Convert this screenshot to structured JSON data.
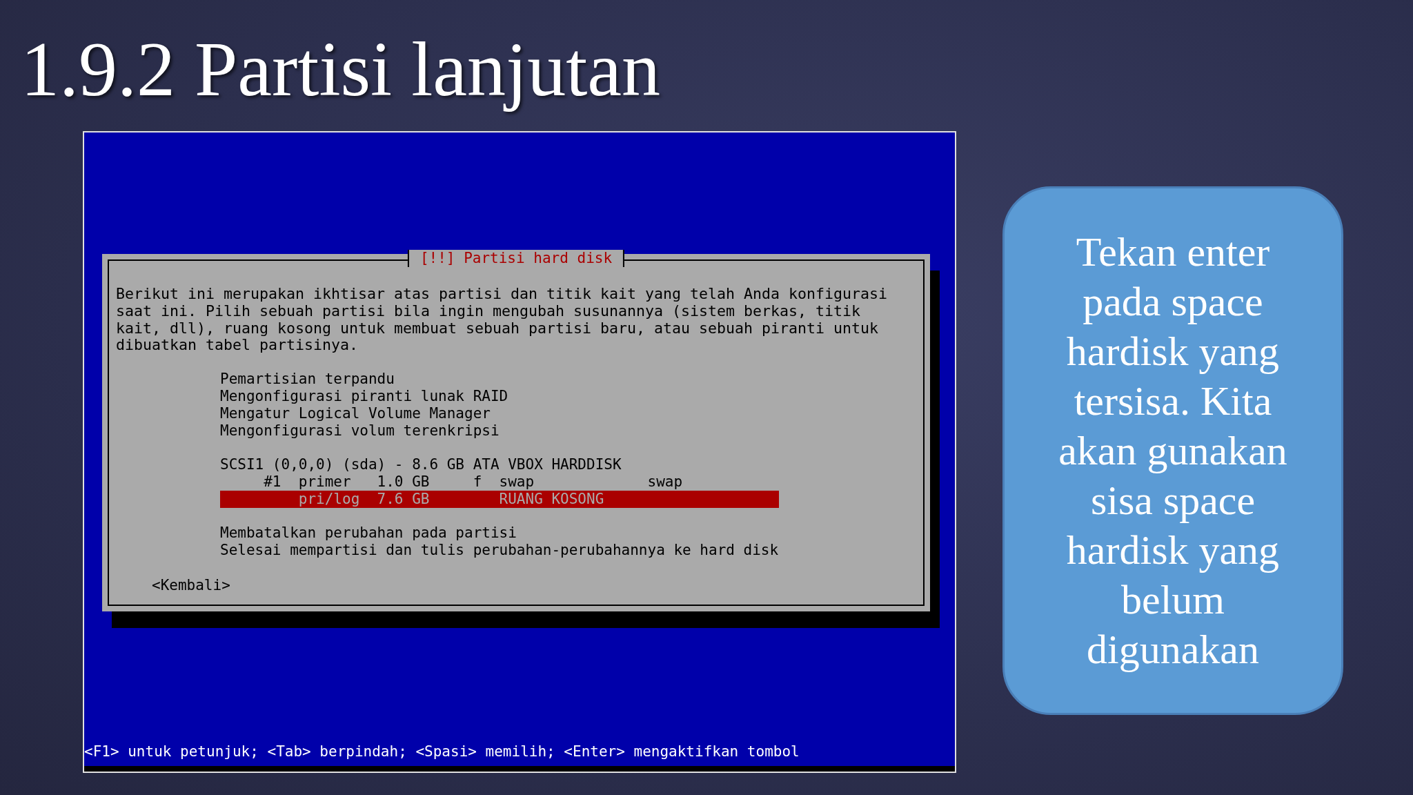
{
  "slide_title": "1.9.2 Partisi lanjutan",
  "installer": {
    "dialog_title": "[!!] Partisi hard disk",
    "description": "Berikut ini merupakan ikhtisar atas partisi dan titik kait yang telah Anda konfigurasi saat ini. Pilih sebuah partisi bila ingin mengubah susunannya (sistem berkas, titik kait, dll), ruang kosong untuk membuat sebuah partisi baru, atau sebuah piranti untuk dibuatkan tabel partisinya.",
    "menu_groups": [
      [
        {
          "text": "Pemartisian terpandu",
          "selected": false
        },
        {
          "text": "Mengonfigurasi piranti lunak RAID",
          "selected": false
        },
        {
          "text": "Mengatur Logical Volume Manager",
          "selected": false
        },
        {
          "text": "Mengonfigurasi volum terenkripsi",
          "selected": false
        }
      ],
      [
        {
          "text": "SCSI1 (0,0,0) (sda) - 8.6 GB ATA VBOX HARDDISK",
          "selected": false
        },
        {
          "text": "     #1  primer   1.0 GB     f  swap             swap",
          "selected": false
        },
        {
          "text": "         pri/log  7.6 GB        RUANG KOSONG",
          "selected": true
        }
      ],
      [
        {
          "text": "Membatalkan perubahan pada partisi",
          "selected": false
        },
        {
          "text": "Selesai mempartisi dan tulis perubahan-perubahannya ke hard disk",
          "selected": false
        }
      ]
    ],
    "back_button": "<Kembali>",
    "help_line": "<F1> untuk petunjuk; <Tab> berpindah; <Spasi> memilih; <Enter> mengaktifkan tombol"
  },
  "callout": "Tekan enter pada space hardisk yang tersisa. Kita akan gunakan sisa space hardisk yang belum digunakan"
}
